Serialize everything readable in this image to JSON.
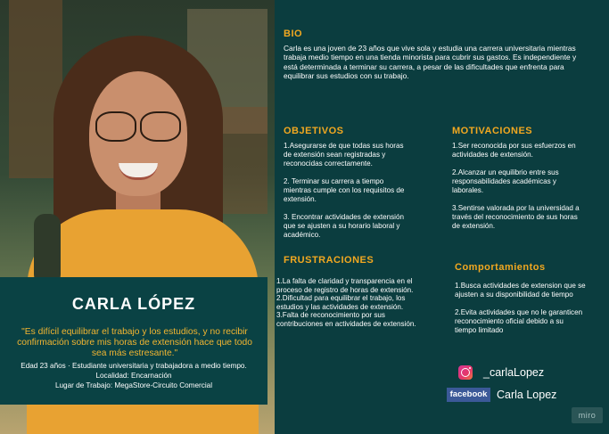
{
  "persona": {
    "name": "CARLA LÓPEZ",
    "quote": "\"Es difícil equilibrar el trabajo y los estudios, y no recibir confirmación sobre mis horas de extensión hace que todo sea más estresante.\"",
    "meta": [
      "Edad 23 años · Estudiante universitaria y trabajadora a medio tiempo.",
      "Localidad: Encarnación",
      "Lugar de Trabajo: MegaStore-Circuito Comercial"
    ]
  },
  "bio": {
    "title": "BIO",
    "text": "Carla es una joven de 23 años que vive sola y estudia una carrera universitaria mientras trabaja medio tiempo en una tienda minorista para cubrir sus gastos. Es independiente y está determinada a terminar su carrera, a pesar de las dificultades que enfrenta para equilibrar sus estudios con su trabajo."
  },
  "objetivos": {
    "title": "OBJETIVOS",
    "items": [
      "1.Asegurarse de que todas sus horas de extensión sean registradas y reconocidas correctamente.",
      "2. Terminar su carrera a tiempo mientras cumple con los requisitos de extensión.",
      "3. Encontrar actividades de extensión que se ajusten a su horario laboral y académico."
    ]
  },
  "motivaciones": {
    "title": "MOTIVACIONES",
    "items": [
      "1.Ser reconocida por sus esfuerzos en actividades de extensión.",
      "2.Alcanzar un equilibrio entre sus responsabilidades académicas y laborales.",
      "3.Sentirse valorada por la universidad a través del reconocimiento de sus horas de extensión."
    ]
  },
  "frustraciones": {
    "title": "FRUSTRACIONES",
    "items": [
      "1.La falta de claridad y transparencia en el proceso de registro de horas de extensión.",
      "2.Dificultad para equilibrar el trabajo, los estudios y las actividades de extensión.",
      "3.Falta de reconocimiento por sus contribuciones en actividades de extensión."
    ]
  },
  "comportamientos": {
    "title": "Comportamientos",
    "items": [
      "1.Busca actividades de extension que se ajusten a su disponibilidad de tiempo",
      "2.Evita actividades que no le garanticen reconocimiento oficial debido a su tiempo limitado"
    ]
  },
  "social": {
    "instagram_icon": "instagram-icon",
    "instagram_handle": "_carlaLopez",
    "facebook_icon_label": "facebook",
    "facebook_name": "Carla Lopez"
  },
  "watermark": "miro",
  "colors": {
    "background": "#0b3d3f",
    "heading": "#f2a820",
    "quote": "#f2b531",
    "text": "#ffffff"
  }
}
